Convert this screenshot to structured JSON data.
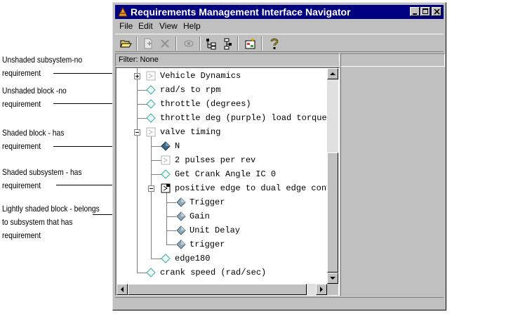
{
  "window": {
    "title": "Requirements Management Interface Navigator"
  },
  "menu": [
    "File",
    "Edit",
    "View",
    "Help"
  ],
  "toolbar_icons": [
    "open-folder-icon",
    "new-link-icon",
    "delete-icon",
    "view-icon",
    "tree-expand-icon",
    "tree-collapse-icon",
    "new-block-icon",
    "help-icon"
  ],
  "filter": {
    "label": "Filter: None"
  },
  "tree": {
    "items": [
      {
        "label": "Vehicle Dynamics",
        "icon": "unshaded-subsystem-icon"
      },
      {
        "label": "rad/s to rpm",
        "icon": "unshaded-block-icon"
      },
      {
        "label": "throttle (degrees)",
        "icon": "unshaded-block-icon"
      },
      {
        "label": "throttle deg (purple) load torque N",
        "icon": "unshaded-block-icon"
      },
      {
        "label": "valve timing",
        "icon": "unshaded-subsystem-icon"
      },
      {
        "label": "N",
        "icon": "shaded-block-icon"
      },
      {
        "label": "2 pulses per rev",
        "icon": "unshaded-subsystem-icon"
      },
      {
        "label": "Get Crank Angle IC 0",
        "icon": "unshaded-block-icon"
      },
      {
        "label": "positive edge to dual edge conversion",
        "icon": "shaded-subsystem-icon"
      },
      {
        "label": "Trigger",
        "icon": "lightly-shaded-block-icon"
      },
      {
        "label": "Gain",
        "icon": "lightly-shaded-block-icon"
      },
      {
        "label": "Unit Delay",
        "icon": "lightly-shaded-block-icon"
      },
      {
        "label": "trigger",
        "icon": "lightly-shaded-block-icon"
      },
      {
        "label": "edge180",
        "icon": "unshaded-block-icon"
      },
      {
        "label": "crank speed (rad/sec)",
        "icon": "unshaded-block-icon"
      }
    ]
  },
  "annotations": [
    {
      "lines": [
        "Unshaded subsystem-no",
        "requirement"
      ]
    },
    {
      "lines": [
        "Unshaded block -no",
        "requirement"
      ]
    },
    {
      "lines": [
        "Shaded block - has",
        "requirement"
      ]
    },
    {
      "lines": [
        "Shaded subsystem - has",
        "requirement"
      ]
    },
    {
      "lines": [
        "Lightly shaded block - belongs",
        "to subsystem that has",
        "requirement"
      ]
    }
  ],
  "colors": {
    "title_bar": "#000080",
    "window_bg": "#c0c0c0",
    "tree_bg": "#ffffff",
    "icon_cyan": "#3fa7a0",
    "icon_dark": "#2a4d6e"
  }
}
